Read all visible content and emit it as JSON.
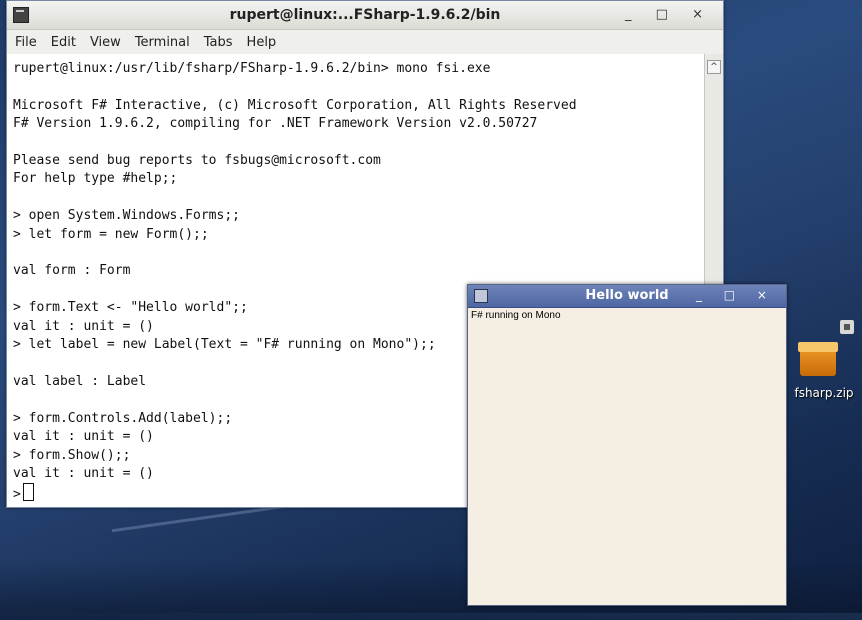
{
  "terminal": {
    "title": "rupert@linux:...FSharp-1.9.6.2/bin",
    "window_controls": "_ □ ×",
    "menu": [
      "File",
      "Edit",
      "View",
      "Terminal",
      "Tabs",
      "Help"
    ],
    "lines": [
      "rupert@linux:/usr/lib/fsharp/FSharp-1.9.6.2/bin> mono fsi.exe",
      "",
      "Microsoft F# Interactive, (c) Microsoft Corporation, All Rights Reserved",
      "F# Version 1.9.6.2, compiling for .NET Framework Version v2.0.50727",
      "",
      "Please send bug reports to fsbugs@microsoft.com",
      "For help type #help;;",
      "",
      "> open System.Windows.Forms;;",
      "> let form = new Form();;",
      "",
      "val form : Form",
      "",
      "> form.Text <- \"Hello world\";;",
      "val it : unit = ()",
      "> let label = new Label(Text = \"F# running on Mono\");;",
      "",
      "val label : Label",
      "",
      "> form.Controls.Add(label);;",
      "val it : unit = ()",
      "> form.Show();;",
      "val it : unit = ()"
    ],
    "prompt": ">"
  },
  "hello_window": {
    "title": "Hello world",
    "window_controls": "_ □ ×",
    "label_text": "F# running on Mono"
  },
  "desktop": {
    "icon_label": "fsharp.zip"
  }
}
